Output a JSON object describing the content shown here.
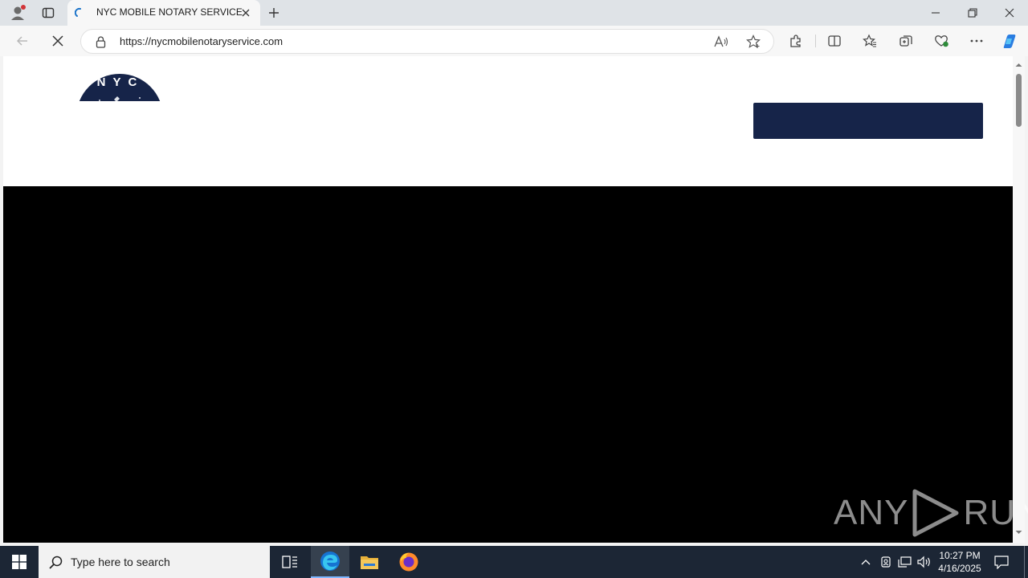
{
  "browser": {
    "tab": {
      "title": "NYC MOBILE NOTARY SERVICE"
    },
    "address": {
      "url": "https://nycmobilenotaryservice.com"
    }
  },
  "site": {
    "logo": {
      "text": "NYC"
    },
    "colors": {
      "navy": "#162449",
      "hero": "#000000"
    }
  },
  "watermark": {
    "left": "ANY",
    "right": "RUN"
  },
  "taskbar": {
    "search_placeholder": "Type here to search",
    "time": "10:27 PM",
    "date": "4/16/2025"
  }
}
